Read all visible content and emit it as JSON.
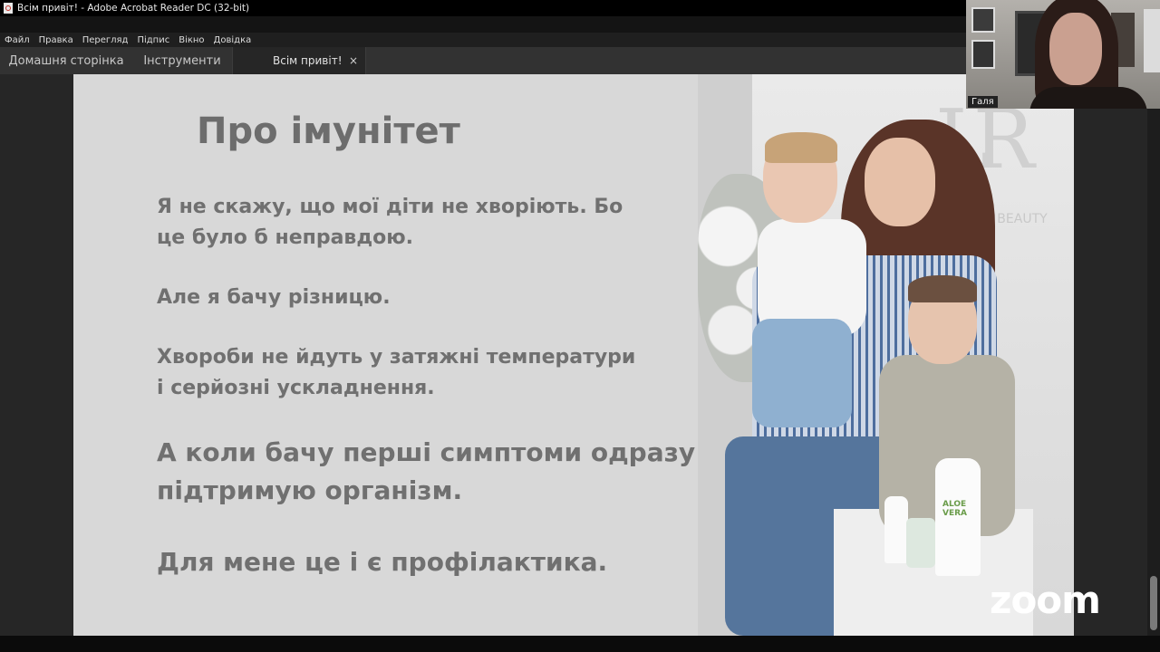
{
  "window": {
    "title": "Всім привіт! - Adobe Acrobat Reader DC (32-bit)"
  },
  "menu": [
    "Файл",
    "Правка",
    "Перегляд",
    "Підпис",
    "Вікно",
    "Довідка"
  ],
  "tabs": {
    "home": "Домашня сторінка",
    "tools": "Інструменти",
    "document": "Всім привіт!",
    "close": "×"
  },
  "slide": {
    "title": "Про імунітет",
    "paragraphs": [
      "Я не скажу, що мої діти не хворіють. Бо\nце було б неправдою.",
      "Але я бачу різницю.",
      "Хвороби не йдуть у затяжні температури\nі серйозні ускладнення.",
      "А коли бачу перші симптоми одразу\nпідтримую організм.",
      "Для мене це і є профілактика."
    ],
    "photo_logo": "LR",
    "photo_tagline": "N & BEAUTY",
    "bottle_label": "ALOE\nVERA"
  },
  "video": {
    "participant_name": "Галя"
  },
  "zoom_watermark": "zoom",
  "colors": {
    "slide_bg": "#d8d8d8",
    "slide_text": "#707070",
    "app_bg": "#262626"
  }
}
